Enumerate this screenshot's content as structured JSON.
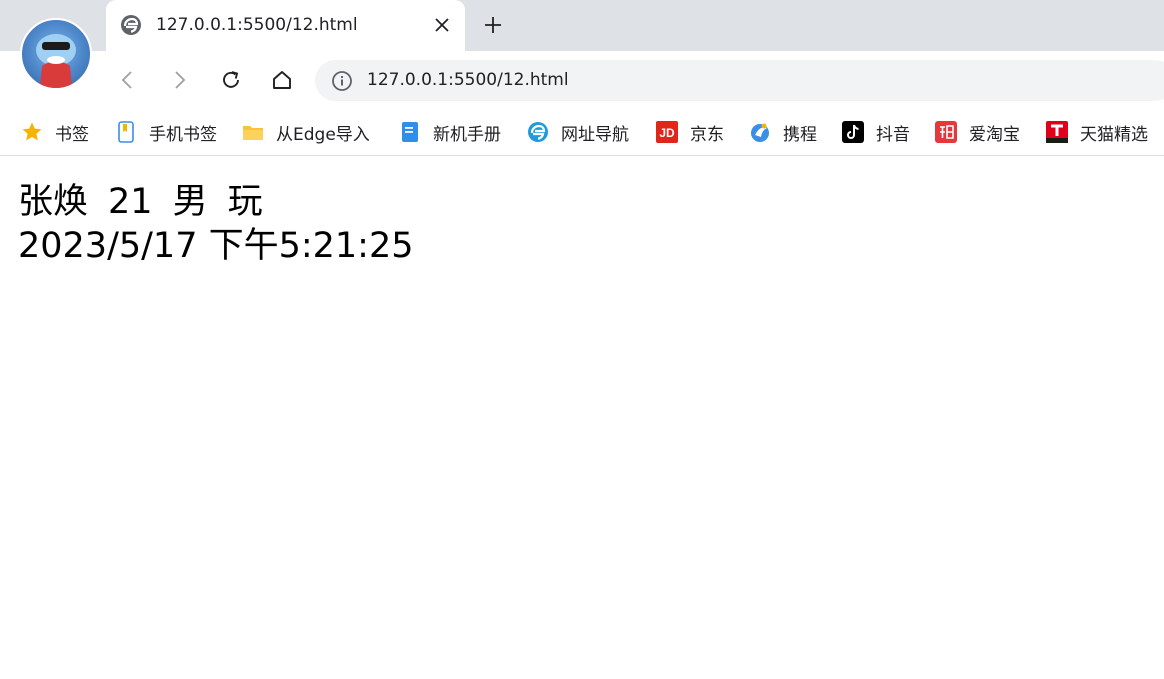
{
  "tab": {
    "title": "127.0.0.1:5500/12.html",
    "favicon": "edge-page-icon"
  },
  "toolbar": {
    "url": "127.0.0.1:5500/12.html",
    "back": "back-arrow-icon",
    "forward": "forward-arrow-icon",
    "reload": "reload-icon",
    "home": "home-icon",
    "info": "site-info-icon"
  },
  "bookmarks": [
    {
      "label": "书签",
      "icon": "star-icon"
    },
    {
      "label": "手机书签",
      "icon": "phone-bookmark-icon"
    },
    {
      "label": "从Edge导入",
      "icon": "folder-icon"
    },
    {
      "label": "新机手册",
      "icon": "manual-icon"
    },
    {
      "label": "网址导航",
      "icon": "edge-icon"
    },
    {
      "label": "京东",
      "icon": "jd-icon"
    },
    {
      "label": "携程",
      "icon": "ctrip-icon"
    },
    {
      "label": "抖音",
      "icon": "douyin-icon"
    },
    {
      "label": "爱淘宝",
      "icon": "taobao-icon"
    },
    {
      "label": "天猫精选",
      "icon": "tmall-icon"
    }
  ],
  "content": {
    "name": "张焕",
    "age": "21",
    "gender": "男",
    "hobby": "玩",
    "datetime": "2023/5/17 下午5:21:25"
  },
  "colors": {
    "tabstrip": "#dee1e6",
    "omnibox": "#f1f3f4",
    "jd_red": "#e1251b",
    "taobao_red": "#e4393c"
  }
}
